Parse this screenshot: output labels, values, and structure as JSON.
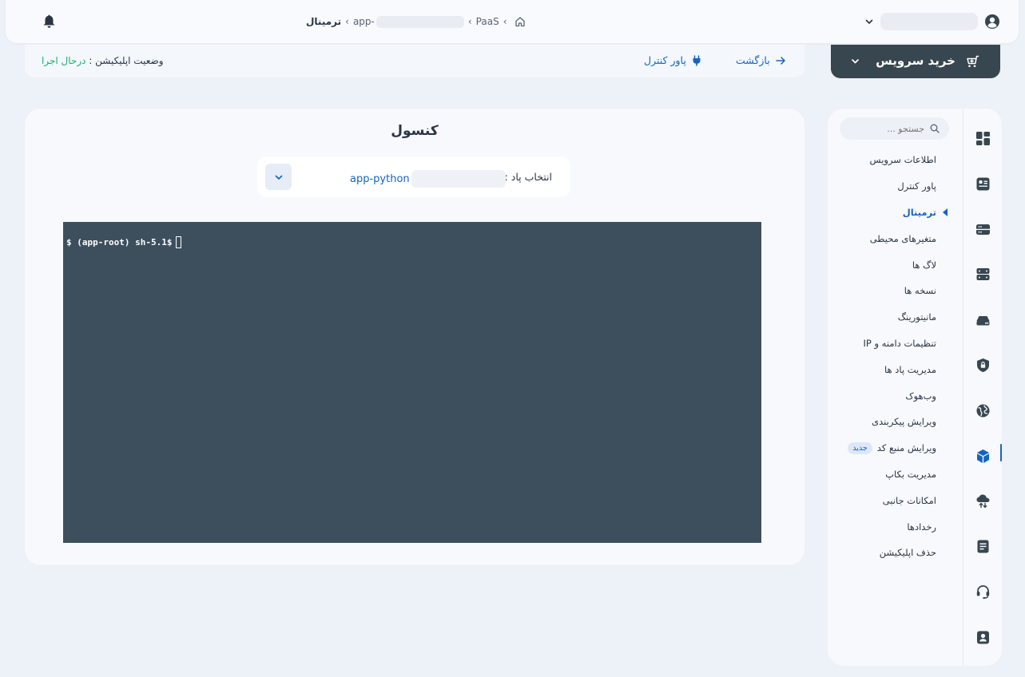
{
  "header": {
    "breadcrumb": {
      "current": "ترمینال",
      "app_prefix": "app-",
      "paas": "PaaS"
    }
  },
  "status_bar": {
    "back_label": "بازگشت",
    "power_label": "پاور کنترل",
    "status_label": "وضعیت اپلیکیشن :",
    "status_value": "درحال اجرا"
  },
  "buy_service": {
    "label": "خرید سرویس"
  },
  "console": {
    "title": "کنسول",
    "pod_label": "انتخاب پاد :",
    "pod_value": "app-python",
    "terminal_prompt": "$ (app-root) sh-5.1$"
  },
  "sidebar": {
    "search_placeholder": "جستجو ...",
    "items": [
      {
        "label": "اطلاعات سرویس"
      },
      {
        "label": "پاور کنترل"
      },
      {
        "label": "ترمینال"
      },
      {
        "label": "متغیرهای محیطی"
      },
      {
        "label": "لاگ ها"
      },
      {
        "label": "نسخه ها"
      },
      {
        "label": "مانیتورینگ"
      },
      {
        "label": "تنظیمات دامنه و IP"
      },
      {
        "label": "مدیریت پاد ها"
      },
      {
        "label": "وب‌هوک"
      },
      {
        "label": "ویرایش پیکربندی"
      },
      {
        "label": "ویرایش منبع کد",
        "badge": "جدید"
      },
      {
        "label": "مدیریت بکاپ"
      },
      {
        "label": "امکانات جانبی"
      },
      {
        "label": "رخدادها"
      },
      {
        "label": "حذف اپلیکیشن"
      }
    ],
    "active_item": "ترمینال",
    "rail_icons": [
      "dashboard-icon",
      "id-card-icon",
      "server-icon",
      "database-icon",
      "cloud-drive-icon",
      "security-shield-icon",
      "globe-icon",
      "cube-icon",
      "cloud-transfer-icon",
      "document-icon",
      "headset-icon",
      "user-badge-icon"
    ]
  },
  "colors": {
    "accent": "#1565c0",
    "status_running": "#18b06f",
    "terminal_bg": "#3d4f5c",
    "buy_button_bg": "#37464f",
    "page_bg": "#edf1f8"
  }
}
